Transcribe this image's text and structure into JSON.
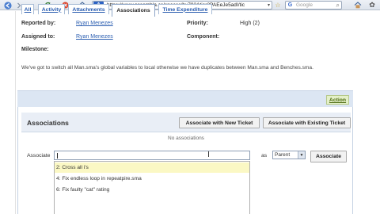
{
  "browser": {
    "back_icon": "back-arrow-icon",
    "forward_icon": "forward-arrow-icon",
    "url": "https://www.assembla.cc/spaces/bv793Atiar3PAEeJe5adI/tic",
    "site_icon_letter": "A",
    "search_placeholder": "Google",
    "search_engine_letter": "G",
    "right_icons": [
      "home-icon",
      "gear-icon"
    ]
  },
  "ticket": {
    "reported_by_label": "Reported by:",
    "reported_by_value": "Ryan Menezes",
    "assigned_to_label": "Assigned to:",
    "assigned_to_value": "Ryan Menezes",
    "milestone_label": "Milestone:",
    "priority_label": "Priority:",
    "priority_value": "High (2)",
    "component_label": "Component:",
    "description": "We've got to switch all Man.sma's global variables to local otherwise we have duplicates between Man.sma and Benches.sma."
  },
  "tabs": [
    {
      "label": "All",
      "active": false
    },
    {
      "label": "Activity",
      "active": false
    },
    {
      "label": "Attachments",
      "active": false
    },
    {
      "label": "Associations",
      "active": true
    },
    {
      "label": "Time Expenditure",
      "active": false
    }
  ],
  "action_label": "Action",
  "associations": {
    "title": "Associations",
    "new_ticket_button": "Associate with New Ticket",
    "existing_ticket_button": "Associate with Existing Ticket",
    "empty_text": "No associations",
    "associate_label": "Associate",
    "input_value": "",
    "as_label": "as",
    "relation_selected": "Parent",
    "associate_button": "Associate",
    "suggestions": [
      {
        "text": "2: Cross all i's",
        "highlighted": true
      },
      {
        "text": "4: Fix endless loop in repeatpire.sma",
        "highlighted": false
      },
      {
        "text": "6: Fix faulty \"cat\" rating",
        "highlighted": false
      }
    ]
  },
  "colors": {
    "link": "#2a5db0",
    "tab_bar": "#dce6f3",
    "highlight": "#fbf8c4",
    "action_bg": "#e4f0c8"
  }
}
